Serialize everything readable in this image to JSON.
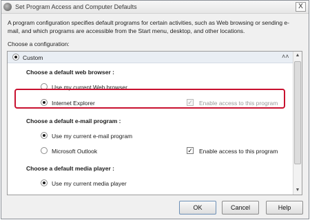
{
  "window": {
    "title": "Set Program Access and Computer Defaults",
    "close_label": "X"
  },
  "description": "A program configuration specifies default programs for certain activities, such as Web browsing or sending e-mail, and which programs are accessible from the Start menu, desktop, and other locations.",
  "choose_label": "Choose a configuration:",
  "config": {
    "custom_label": "Custom",
    "custom_selected": true,
    "collapse_icon": "double-chevron-up-icon"
  },
  "sections": {
    "browser": {
      "heading": "Choose a default web browser :",
      "option1": "Use my current Web browser",
      "option2": "Internet Explorer",
      "selected": "option2",
      "enable_label": "Enable access to this program",
      "enable_checked": true,
      "enable_disabled": true
    },
    "email": {
      "heading": "Choose a default e-mail program :",
      "option1": "Use my current e-mail program",
      "option2": "Microsoft Outlook",
      "selected": "option1",
      "enable_label": "Enable access to this program",
      "enable_checked": true,
      "enable_disabled": false
    },
    "media": {
      "heading": "Choose a default media player :",
      "option1": "Use my current media player",
      "selected": "option1"
    }
  },
  "buttons": {
    "ok": "OK",
    "cancel": "Cancel",
    "help": "Help"
  },
  "colors": {
    "highlight": "#c8102e"
  }
}
